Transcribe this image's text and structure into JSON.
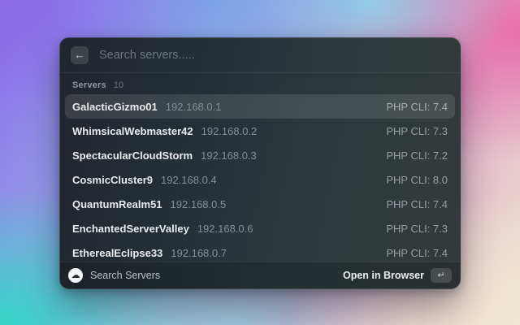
{
  "colors": {
    "bg_top_left": "#8a6ce9",
    "bg_top_center": "#7aa0e8",
    "bg_top_right": "#e771ab",
    "bg_bottom_left": "#35d6c8",
    "bg_bottom_right": "#f0e8d2",
    "window_base": "#262e33",
    "selection": "rgba(255,255,255,0.115)"
  },
  "search": {
    "back_icon": "←",
    "placeholder": "Search servers....."
  },
  "section": {
    "label": "Servers",
    "count": "10"
  },
  "servers": [
    {
      "name": "GalacticGizmo01",
      "ip": "192.168.0.1",
      "accessory": "PHP CLI: 7.4",
      "selected": true
    },
    {
      "name": "WhimsicalWebmaster42",
      "ip": "192.168.0.2",
      "accessory": "PHP CLI: 7.3",
      "selected": false
    },
    {
      "name": "SpectacularCloudStorm",
      "ip": "192.168.0.3",
      "accessory": "PHP CLI: 7.2",
      "selected": false
    },
    {
      "name": "CosmicCluster9",
      "ip": "192.168.0.4",
      "accessory": "PHP CLI: 8.0",
      "selected": false
    },
    {
      "name": "QuantumRealm51",
      "ip": "192.168.0.5",
      "accessory": "PHP CLI: 7.4",
      "selected": false
    },
    {
      "name": "EnchantedServerValley",
      "ip": "192.168.0.6",
      "accessory": "PHP CLI: 7.3",
      "selected": false
    },
    {
      "name": "EtherealEclipse33",
      "ip": "192.168.0.7",
      "accessory": "PHP CLI: 7.4",
      "selected": false
    }
  ],
  "footer": {
    "app_icon": "☁",
    "app_label": "Search Servers",
    "action_label": "Open in Browser",
    "action_key": "↵"
  }
}
